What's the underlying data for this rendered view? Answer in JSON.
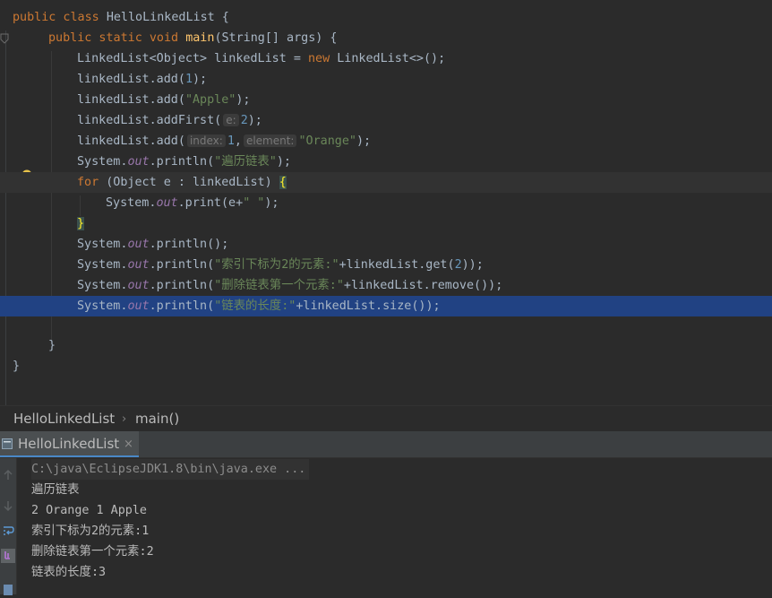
{
  "editor": {
    "l1": {
      "kw": "public class ",
      "cls": "HelloLinkedList",
      "rest": " {"
    },
    "l2": {
      "kw": "public static void ",
      "fn": "main",
      "rest": "(String[] args) {"
    },
    "l3": {
      "a": "LinkedList<Object> linkedList = ",
      "kw": "new",
      "b": " LinkedList<>();"
    },
    "l4": {
      "a": "linkedList.add(",
      "n": "1",
      "b": ");"
    },
    "l5": {
      "a": "linkedList.add(",
      "s": "\"Apple\"",
      "b": ");"
    },
    "l6": {
      "a": "linkedList.addFirst(",
      "hint": "e:",
      "n": "2",
      "b": ");"
    },
    "l7": {
      "a": "linkedList.add(",
      "hint1": "index:",
      "n": "1",
      "comma": ",",
      "hint2": "element:",
      "s": "\"Orange\"",
      "b": ");"
    },
    "l8": {
      "a": "System.",
      "f": "out",
      "b": ".println(",
      "s": "\"遍历链表\"",
      "c": ");"
    },
    "l9": {
      "kw": "for",
      "a": " (Object e : linkedList) ",
      "brace": "{"
    },
    "l10": {
      "a": "System.",
      "f": "out",
      "b": ".print(e+",
      "s": "\" \"",
      "c": ");"
    },
    "l11": {
      "brace": "}"
    },
    "l12": {
      "a": "System.",
      "f": "out",
      "b": ".println();"
    },
    "l13": {
      "a": "System.",
      "f": "out",
      "b": ".println(",
      "s": "\"索引下标为2的元素:\"",
      "c": "+linkedList.get(",
      "n": "2",
      "d": "));"
    },
    "l14": {
      "a": "System.",
      "f": "out",
      "b": ".println(",
      "s": "\"删除链表第一个元素:\"",
      "c": "+linkedList.remove());"
    },
    "l15": {
      "a": "System.",
      "f": "out",
      "b": ".println(",
      "s": "\"链表的长度:\"",
      "c": "+linkedList.size());"
    },
    "l16": {
      "a": "}"
    },
    "l17": {
      "a": "}"
    }
  },
  "breadcrumb": {
    "cls": "HelloLinkedList",
    "sep": "›",
    "method": "main()"
  },
  "run": {
    "tab_label": "HelloLinkedList",
    "close": "×"
  },
  "console": {
    "lines": [
      "C:\\java\\EclipseJDK1.8\\bin\\java.exe ...",
      "遍历链表",
      "2 Orange 1 Apple",
      "索引下标为2的元素:1",
      "删除链表第一个元素:2",
      "链表的长度:3"
    ]
  },
  "colors": {
    "keyword": "#cc7832",
    "function": "#ffc66d",
    "number": "#6897bb",
    "string": "#6a8759",
    "field": "#9876aa",
    "selection": "#214283"
  }
}
